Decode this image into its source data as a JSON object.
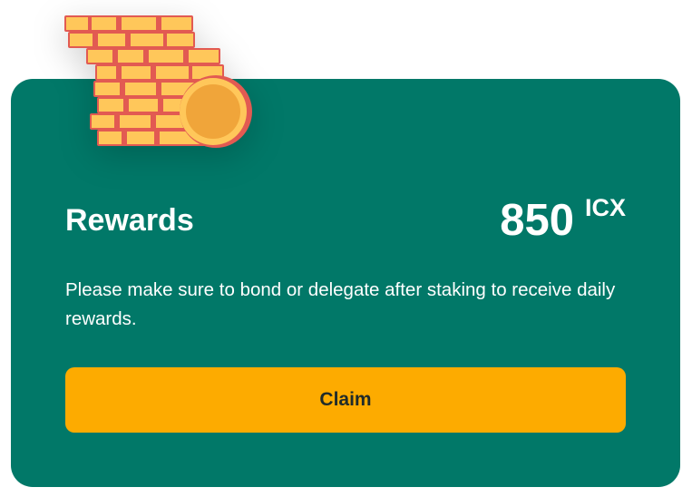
{
  "rewards": {
    "title": "Rewards",
    "amount": "850",
    "unit": "ICX",
    "description": "Please make sure to bond or delegate after staking to receive daily rewards.",
    "claim_label": "Claim",
    "illustration_icon": "coin-stack-icon"
  },
  "colors": {
    "card_bg": "#017868",
    "button_bg": "#fdab00",
    "coin_fill": "#ffc75a",
    "coin_edge": "#e25a52",
    "coin_face": "#f0a53a"
  }
}
